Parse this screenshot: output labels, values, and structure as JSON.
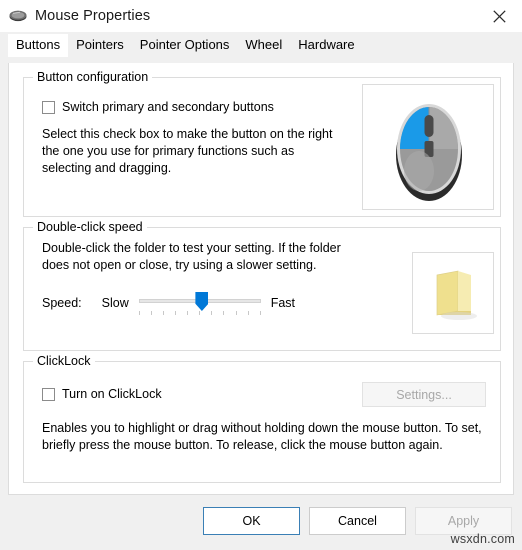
{
  "window": {
    "title": "Mouse Properties",
    "icon": "mouse-icon",
    "close_label": "Close"
  },
  "tabs": [
    {
      "label": "Buttons",
      "active": true
    },
    {
      "label": "Pointers",
      "active": false
    },
    {
      "label": "Pointer Options",
      "active": false
    },
    {
      "label": "Wheel",
      "active": false
    },
    {
      "label": "Hardware",
      "active": false
    }
  ],
  "button_configuration": {
    "group_title": "Button configuration",
    "switch_buttons_label": "Switch primary and secondary buttons",
    "switch_buttons_checked": false,
    "description": "Select this check box to make the button on the right the one you use for primary functions such as selecting and dragging.",
    "preview_icon": "mouse-preview-icon",
    "mouse_primary_color": "#1a9ae8",
    "mouse_body_color": "#9a9a9a"
  },
  "double_click_speed": {
    "group_title": "Double-click speed",
    "description": "Double-click the folder to test your setting. If the folder does not open or close, try using a slower setting.",
    "speed_label": "Speed:",
    "slow_label": "Slow",
    "fast_label": "Fast",
    "slider_value": 52,
    "slider_min": 0,
    "slider_max": 100,
    "tick_count": 11,
    "thumb_color": "#0078d7",
    "preview_icon": "folder-icon",
    "folder_color": "#f2dc8c"
  },
  "clicklock": {
    "group_title": "ClickLock",
    "turn_on_label": "Turn on ClickLock",
    "turn_on_checked": false,
    "settings_button_label": "Settings...",
    "settings_button_enabled": false,
    "description": "Enables you to highlight or drag without holding down the mouse button. To set, briefly press the mouse button. To release, click the mouse button again."
  },
  "footer": {
    "ok_label": "OK",
    "cancel_label": "Cancel",
    "apply_label": "Apply",
    "apply_enabled": false,
    "ok_is_default": true
  },
  "watermark": "wsxdn.com"
}
